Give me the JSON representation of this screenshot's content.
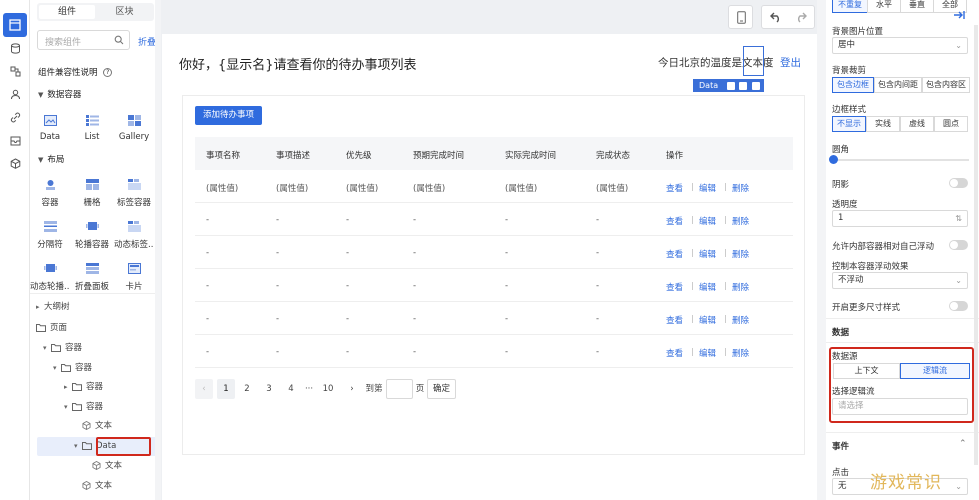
{
  "panel": {
    "tab_components": "组件",
    "tab_blocks": "区块",
    "search_placeholder": "搜索组件",
    "collapse": "折叠",
    "compat_note": "组件兼容性说明",
    "section_data": "数据容器",
    "data_items": [
      "Data",
      "List",
      "Gallery"
    ],
    "section_layout": "布局",
    "layout_items": [
      "容器",
      "栅格",
      "标签容器",
      "分隔符",
      "轮播容器",
      "动态标签...",
      "动态轮播...",
      "折叠面板",
      "卡片"
    ],
    "outline_title": "大纲树",
    "tree": [
      "页面",
      "容器",
      "容器",
      "容器",
      "容器",
      "文本",
      "Data",
      "文本",
      "文本"
    ]
  },
  "canvas": {
    "greeting": "你好，{显示名}请查看你的待办事项列表",
    "weather_prefix": "今日北京的温度是",
    "weather_value": "文本度",
    "logout": "登出",
    "data_tag": "Data",
    "add_button": "添加待办事项",
    "columns": [
      "事项名称",
      "事项描述",
      "优先级",
      "预期完成时间",
      "实际完成时间",
      "完成状态",
      "操作"
    ],
    "rows": [
      [
        "(属性值)",
        "(属性值)",
        "(属性值)",
        "(属性值)",
        "(属性值)",
        "(属性值)"
      ],
      [
        "-",
        "-",
        "-",
        "-",
        "-",
        "-"
      ],
      [
        "-",
        "-",
        "-",
        "-",
        "-",
        "-"
      ],
      [
        "-",
        "-",
        "-",
        "-",
        "-",
        "-"
      ],
      [
        "-",
        "-",
        "-",
        "-",
        "-",
        "-"
      ],
      [
        "-",
        "-",
        "-",
        "-",
        "-",
        "-"
      ]
    ],
    "actions": [
      "查看",
      "编辑",
      "删除"
    ],
    "pager": {
      "prev": "‹",
      "pages": [
        "1",
        "2",
        "3",
        "4",
        "···",
        "10"
      ],
      "next": "›",
      "goto": "到第",
      "page_unit": "页",
      "confirm": "确定"
    }
  },
  "props": {
    "repeat_options": [
      "不重复",
      "水平",
      "垂直",
      "全部"
    ],
    "bg_pos_label": "背景图片位置",
    "bg_pos_value": "居中",
    "bg_clip_label": "背景裁剪",
    "bg_clip_options": [
      "包含边框",
      "包含内间距",
      "包含内容区"
    ],
    "border_label": "边框样式",
    "border_options": [
      "不显示",
      "实线",
      "虚线",
      "圆点"
    ],
    "radius_label": "圆角",
    "shadow_label": "阴影",
    "opacity_label": "透明度",
    "opacity_value": "1",
    "float_inner_label": "允许内部容器相对自己浮动",
    "float_ctrl_label": "控制本容器浮动效果",
    "float_ctrl_value": "不浮动",
    "more_size_label": "开启更多尺寸样式",
    "data_section": "数据",
    "datasource_label": "数据源",
    "datasource_options": [
      "上下文",
      "逻辑流"
    ],
    "logic_label": "选择逻辑流",
    "logic_placeholder": "请选择",
    "event_section": "事件",
    "click_label": "点击",
    "click_value": "无"
  },
  "watermark": "游戏常识",
  "colors": {
    "accent": "#2f6bde",
    "highlight": "#d0281c"
  }
}
